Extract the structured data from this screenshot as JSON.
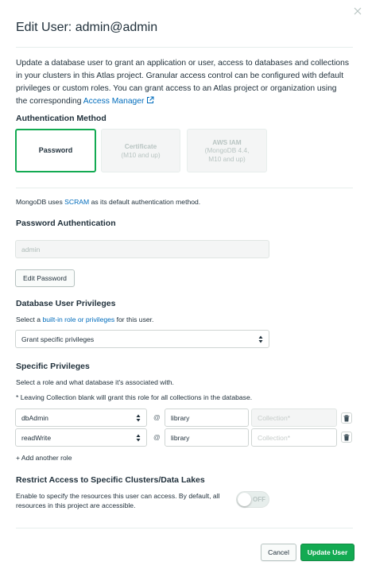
{
  "dialog": {
    "title": "Edit User: admin@admin",
    "description_before": "Update a database user to grant an application or user, access to databases and collections in your clusters in this Atlas project. Granular access control can be configured with default privileges or custom roles. You can grant access to an Atlas project or organization using the corresponding ",
    "description_link": "Access Manager"
  },
  "auth": {
    "heading": "Authentication Method",
    "methods": [
      {
        "label": "Password",
        "sub": ""
      },
      {
        "label": "Certificate",
        "sub": "(M10 and up)"
      },
      {
        "label": "AWS IAM",
        "sub": "(MongoDB 4.4,\nM10 and up)"
      }
    ],
    "scram_before": "MongoDB uses ",
    "scram_link": "SCRAM",
    "scram_after": " as its default authentication method."
  },
  "password_auth": {
    "heading": "Password Authentication",
    "username": "admin",
    "edit_password_label": "Edit Password"
  },
  "privileges": {
    "heading": "Database User Privileges",
    "select_before": "Select a ",
    "select_link": "built-in role or privileges",
    "select_after": " for this user.",
    "selected": "Grant specific privileges"
  },
  "specific": {
    "heading": "Specific Privileges",
    "note1": "Select a role and what database it's associated with.",
    "note2": "* Leaving Collection blank will grant this role for all collections in the database.",
    "at_symbol": "@",
    "rows": [
      {
        "role": "dbAdmin",
        "database": "library",
        "collection_placeholder": "Collection*"
      },
      {
        "role": "readWrite",
        "database": "library",
        "collection_placeholder": "Collection*"
      }
    ],
    "add_role_label": "+ Add another role"
  },
  "restrict": {
    "heading": "Restrict Access to Specific Clusters/Data Lakes",
    "text": "Enable to specify the resources this user can access. By default, all resources in this project are accessible.",
    "toggle_label": "OFF",
    "toggle_on": false
  },
  "footer": {
    "cancel_label": "Cancel",
    "update_label": "Update User"
  },
  "colors": {
    "accent_green": "#13aa52",
    "link_blue": "#006cbc",
    "text_dark": "#21313c"
  },
  "icons": [
    "close-icon",
    "external-link-icon",
    "select-arrows-icon",
    "trash-icon"
  ]
}
